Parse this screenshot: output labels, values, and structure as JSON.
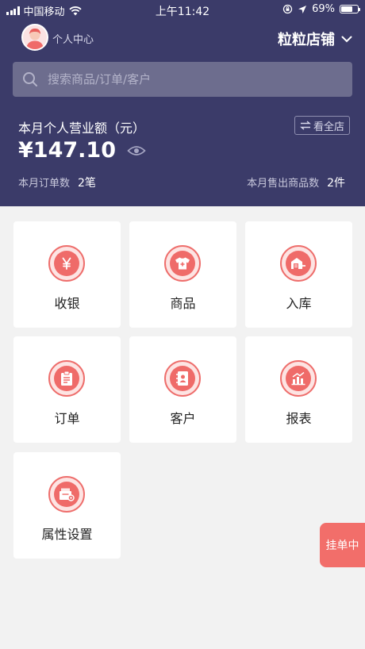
{
  "status_bar": {
    "carrier": "中国移动",
    "time": "上午11:42",
    "battery": "69%",
    "battery_level": 0.69
  },
  "header": {
    "personal_center": "个人中心",
    "store_name": "粒粒店铺",
    "search_placeholder": "搜索商品/订单/客户",
    "revenue_label": "本月个人营业额（元）",
    "view_all": "看全店",
    "revenue_amount": "¥147.10",
    "orders_label": "本月订单数",
    "orders_value": "2笔",
    "sold_label": "本月售出商品数",
    "sold_value": "2件"
  },
  "grid": {
    "items": [
      {
        "label": "收银",
        "icon": "yen-icon"
      },
      {
        "label": "商品",
        "icon": "shirt-icon"
      },
      {
        "label": "入库",
        "icon": "warehouse-icon"
      },
      {
        "label": "订单",
        "icon": "clipboard-icon"
      },
      {
        "label": "客户",
        "icon": "contacts-icon"
      },
      {
        "label": "报表",
        "icon": "bar-chart-icon"
      },
      {
        "label": "属性设置",
        "icon": "box-settings-icon"
      }
    ]
  },
  "pending_tab": {
    "label": "挂单中"
  },
  "colors": {
    "header_bg": "#3b3b69",
    "accent": "#ef6b69",
    "page_bg": "#f2f2f2"
  }
}
